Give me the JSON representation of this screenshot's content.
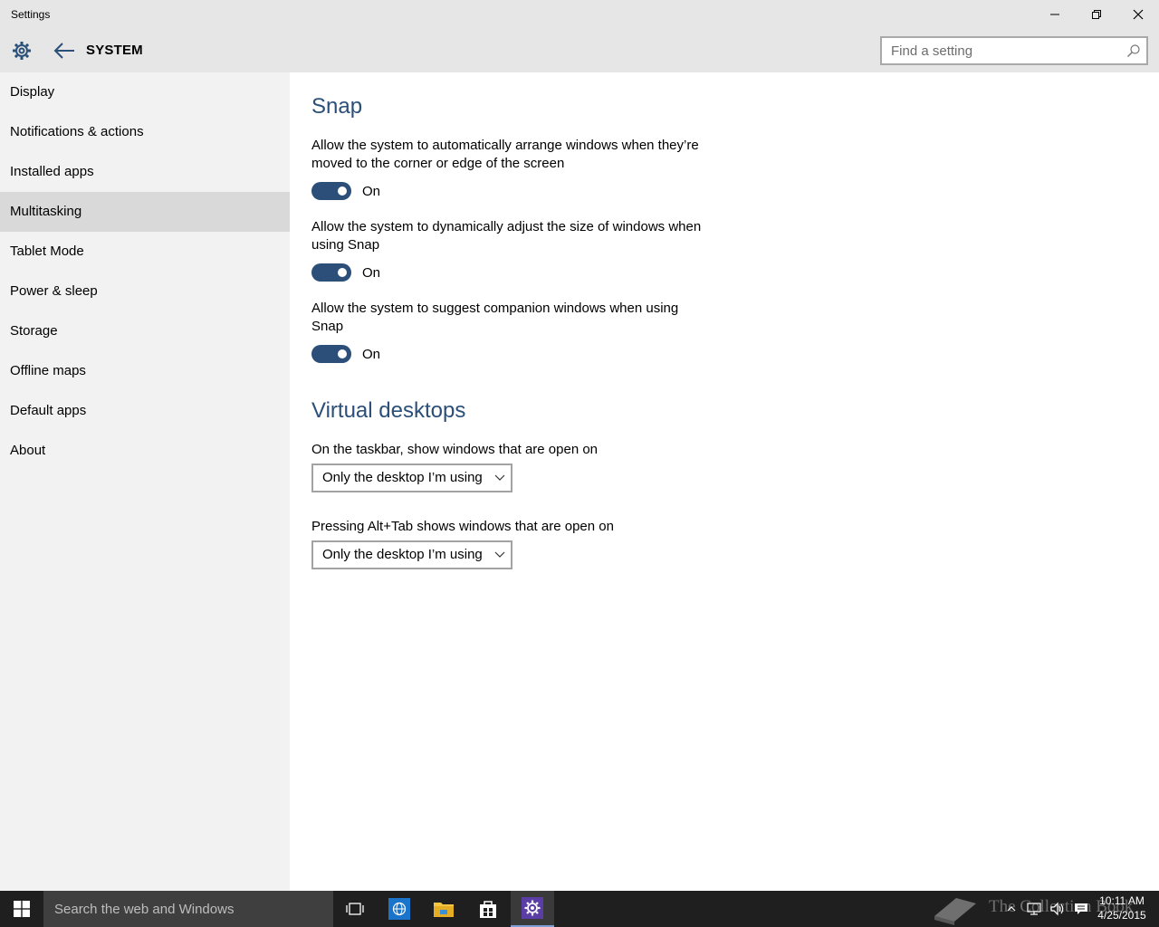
{
  "window": {
    "title": "Settings"
  },
  "header": {
    "section": "SYSTEM",
    "search_placeholder": "Find a setting"
  },
  "sidebar": {
    "items": [
      {
        "label": "Display"
      },
      {
        "label": "Notifications & actions"
      },
      {
        "label": "Installed apps"
      },
      {
        "label": "Multitasking",
        "active": true
      },
      {
        "label": "Tablet Mode"
      },
      {
        "label": "Power & sleep"
      },
      {
        "label": "Storage"
      },
      {
        "label": "Offline maps"
      },
      {
        "label": "Default apps"
      },
      {
        "label": "About"
      }
    ]
  },
  "snap": {
    "heading": "Snap",
    "settings": [
      {
        "description": "Allow the system to automatically arrange windows when they’re moved to the corner or edge of the screen",
        "state": "On"
      },
      {
        "description": "Allow the system to dynamically adjust the size of windows when using Snap",
        "state": "On"
      },
      {
        "description": "Allow the system to suggest companion windows when using Snap",
        "state": "On"
      }
    ]
  },
  "virtual_desktops": {
    "heading": "Virtual desktops",
    "taskbar_label": "On the taskbar, show windows that are open on",
    "taskbar_value": "Only the desktop I’m using",
    "alttab_label": "Pressing Alt+Tab shows windows that are open on",
    "alttab_value": "Only the desktop I’m using"
  },
  "taskbar": {
    "search_placeholder": "Search the web and Windows",
    "watermark": "The Collection Book",
    "time": "10:11 AM",
    "date": "4/25/2015"
  },
  "colors": {
    "accent": "#2b4f78",
    "sidebar_bg": "#f2f2f2",
    "active_item_bg": "#d9d9d9",
    "taskbar_bg": "#1f1f1f"
  }
}
